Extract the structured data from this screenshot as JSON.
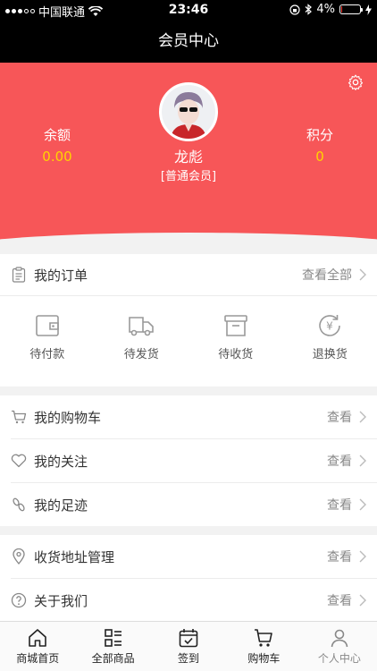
{
  "status_bar": {
    "carrier": "中国联通",
    "time": "23:46",
    "battery": "4%",
    "battery_level": 0.04
  },
  "nav": {
    "title": "会员中心"
  },
  "header": {
    "balance_label": "余额",
    "balance_value": "0.00",
    "points_label": "积分",
    "points_value": "0",
    "username": "龙彪",
    "level": "[普通会员]",
    "accent_color": "#f75658",
    "value_color": "#ffd400"
  },
  "orders": {
    "title": "我的订单",
    "view_all": "查看全部",
    "items": [
      {
        "label": "待付款",
        "icon": "wallet-icon"
      },
      {
        "label": "待发货",
        "icon": "truck-icon"
      },
      {
        "label": "待收货",
        "icon": "box-icon"
      },
      {
        "label": "退换货",
        "icon": "refund-icon"
      }
    ]
  },
  "list1": [
    {
      "label": "我的购物车",
      "action": "查看",
      "icon": "cart-icon"
    },
    {
      "label": "我的关注",
      "action": "查看",
      "icon": "heart-icon"
    },
    {
      "label": "我的足迹",
      "action": "查看",
      "icon": "footprint-icon"
    }
  ],
  "list2": [
    {
      "label": "收货地址管理",
      "action": "查看",
      "icon": "location-icon"
    },
    {
      "label": "关于我们",
      "action": "查看",
      "icon": "question-icon"
    }
  ],
  "tabs": [
    {
      "label": "商城首页",
      "icon": "home-icon"
    },
    {
      "label": "全部商品",
      "icon": "list-icon"
    },
    {
      "label": "签到",
      "icon": "calendar-icon"
    },
    {
      "label": "购物车",
      "icon": "cart-icon"
    },
    {
      "label": "个人中心",
      "icon": "user-icon"
    }
  ]
}
